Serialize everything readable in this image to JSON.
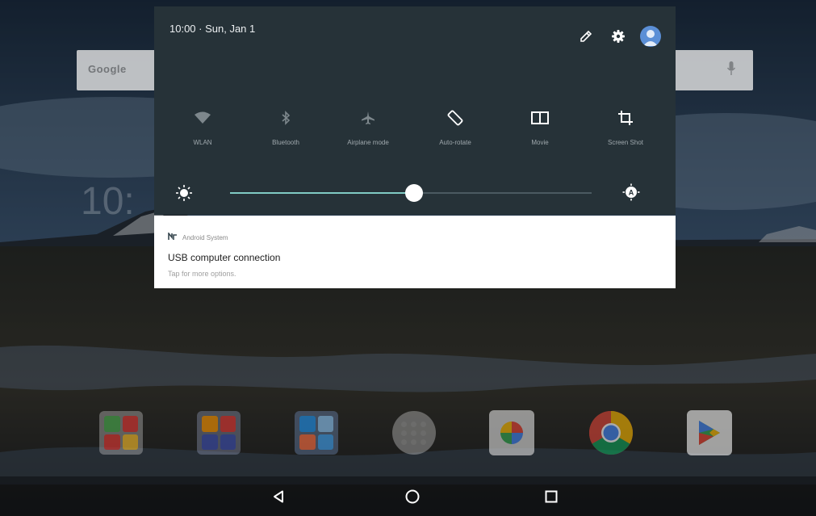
{
  "home": {
    "search_logo": "Google",
    "clock_ghost": "10:"
  },
  "shade": {
    "datetime": "10:00 · Sun, Jan 1"
  },
  "quick_settings": [
    {
      "label": "WLAN",
      "icon": "wifi-icon"
    },
    {
      "label": "Bluetooth",
      "icon": "bluetooth-icon"
    },
    {
      "label": "Airplane mode",
      "icon": "airplane-icon"
    },
    {
      "label": "Auto-rotate",
      "icon": "auto-rotate-icon"
    },
    {
      "label": "Movie",
      "icon": "movie-icon"
    },
    {
      "label": "Screen Shot",
      "icon": "crop-icon"
    }
  ],
  "brightness": {
    "level": 0.51
  },
  "notification": {
    "app_name": "Android System",
    "title": "USB computer connection",
    "text": "Tap for more options."
  },
  "dock": [
    "folder",
    "folder",
    "folder",
    "app-drawer",
    "photos",
    "chrome",
    "play-store"
  ],
  "navigation": [
    "back",
    "home",
    "recents"
  ],
  "colors": {
    "shade_bg": "#263238",
    "slider_accent": "#80cbc4",
    "card_bg": "#ffffff"
  }
}
